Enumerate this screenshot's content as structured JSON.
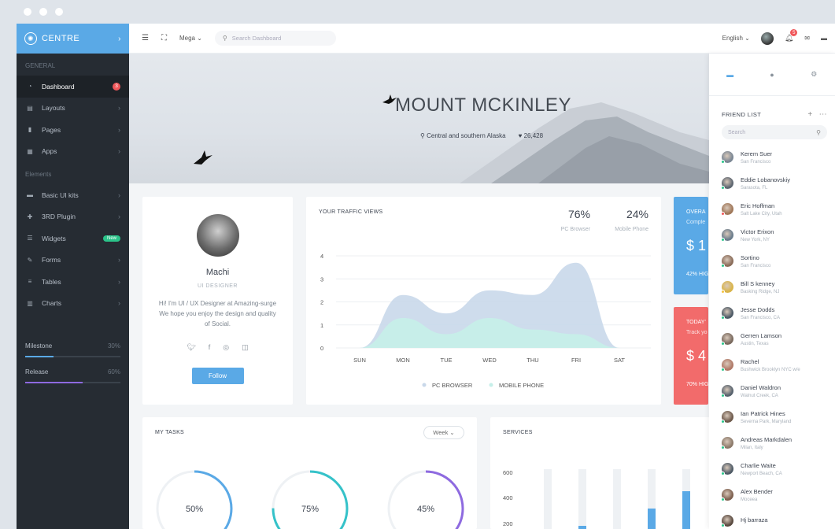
{
  "sidebar": {
    "brand": "CENTRE",
    "general_title": "GENERAL",
    "elements_title": "Elements",
    "general_items": [
      {
        "label": "Dashboard",
        "icon": "dashboard-icon",
        "badge": "3"
      },
      {
        "label": "Layouts",
        "icon": "layouts-icon"
      },
      {
        "label": "Pages",
        "icon": "pages-icon"
      },
      {
        "label": "Apps",
        "icon": "apps-icon"
      }
    ],
    "element_items": [
      {
        "label": "Basic UI kits",
        "icon": "briefcase-icon"
      },
      {
        "label": "3RD Plugin",
        "icon": "puzzle-icon"
      },
      {
        "label": "Widgets",
        "icon": "widgets-icon",
        "badge": "New"
      },
      {
        "label": "Forms",
        "icon": "forms-icon"
      },
      {
        "label": "Tables",
        "icon": "tables-icon"
      },
      {
        "label": "Charts",
        "icon": "charts-icon"
      }
    ],
    "progress": [
      {
        "label": "Milestone",
        "pct": "30%",
        "value": 0.3,
        "color": "#5aa9e6"
      },
      {
        "label": "Release",
        "pct": "60%",
        "value": 0.6,
        "color": "#8e6ae0"
      }
    ]
  },
  "topbar": {
    "mega": "Mega",
    "search_placeholder": "Search Dashboard",
    "language": "English",
    "notif_count": "5"
  },
  "hero": {
    "title": "MOUNT MCKINLEY",
    "location": "Central and southern Alaska",
    "likes": "26,428"
  },
  "profile": {
    "name": "Machi",
    "role": "UI DESIGNER",
    "bio": "Hi! I'm UI / UX Designer at Amazing-surge We hope you enjoy the design and quality of Social.",
    "follow_label": "Follow"
  },
  "traffic": {
    "title": "YOUR TRAFFIC VIEWS",
    "stat1_value": "76%",
    "stat1_label": "PC Browser",
    "stat2_value": "24%",
    "stat2_label": "Mobile Phone"
  },
  "chart_data": {
    "type": "area",
    "categories": [
      "SUN",
      "MON",
      "TUE",
      "WED",
      "THU",
      "FRI",
      "SAT"
    ],
    "ylim": [
      0,
      4
    ],
    "yticks": [
      "0",
      "1",
      "2",
      "3",
      "4"
    ],
    "series": [
      {
        "name": "PC BROWSER",
        "color": "#c9d8ea",
        "values": [
          0,
          2.3,
          1.5,
          2.5,
          2.3,
          3.7,
          0
        ]
      },
      {
        "name": "MOBILE PHONE",
        "color": "#c6efe9",
        "values": [
          0,
          1.3,
          0.6,
          1.3,
          0.8,
          0.6,
          0
        ]
      }
    ]
  },
  "blue_card": {
    "title": "OVERA",
    "sub": "Comple",
    "value": "$ 1",
    "foot": "42% HIG"
  },
  "red_card": {
    "title": "TODAY'",
    "sub": "Track yo",
    "value": "$ 4",
    "foot": "70% HIG"
  },
  "tasks": {
    "title": "MY TASKS",
    "filter": "Week",
    "rings": [
      {
        "label": "50%",
        "value": 0.5,
        "color": "#5aa9e6"
      },
      {
        "label": "75%",
        "value": 0.75,
        "color": "#35c2c9"
      },
      {
        "label": "45%",
        "value": 0.45,
        "color": "#8e6ae0"
      }
    ]
  },
  "services": {
    "title": "SERVICES",
    "yticks": [
      "600",
      "400",
      "200"
    ]
  },
  "right_panel": {
    "friend_list_title": "FRIEND LIST",
    "search_placeholder": "Search",
    "friends": [
      {
        "name": "Kerem Suer",
        "loc": "San Francisco",
        "status": "#2bc48a"
      },
      {
        "name": "Eddie Lobanovskiy",
        "loc": "Sarasota, FL",
        "status": "#2bc48a"
      },
      {
        "name": "Eric Hoffman",
        "loc": "Salt Lake City, Utah",
        "status": "#f0575a"
      },
      {
        "name": "Victor Erixon",
        "loc": "New York, NY",
        "status": "#2bc48a"
      },
      {
        "name": "Sortino",
        "loc": "San Francisco",
        "status": "#2bc48a"
      },
      {
        "name": "Bill S kenney",
        "loc": "Basking Ridge, NJ",
        "status": "#f5c342"
      },
      {
        "name": "Jesse Dodds",
        "loc": "San Francisco, CA",
        "status": "#2bc48a"
      },
      {
        "name": "Gerren Lamson",
        "loc": "Austin, Texas",
        "status": "#2bc48a"
      },
      {
        "name": "Rachel",
        "loc": "Bushwick Brooklyn NYC w/e",
        "status": "#2bc48a"
      },
      {
        "name": "Daniel Waldron",
        "loc": "Walnut Creek, CA",
        "status": "#2bc48a"
      },
      {
        "name": "Ian Patrick Hines",
        "loc": "Severna Park, Maryland",
        "status": "#2bc48a"
      },
      {
        "name": "Andreas Markdalen",
        "loc": "Milan, Italy",
        "status": "#2bc48a"
      },
      {
        "name": "Charlie Waite",
        "loc": "Newport Beach, CA",
        "status": "#2bc48a"
      },
      {
        "name": "Alex Bender",
        "loc": "Moceea",
        "status": "#2bc48a"
      },
      {
        "name": "Hj barraza",
        "loc": "",
        "status": "#2bc48a"
      }
    ]
  }
}
